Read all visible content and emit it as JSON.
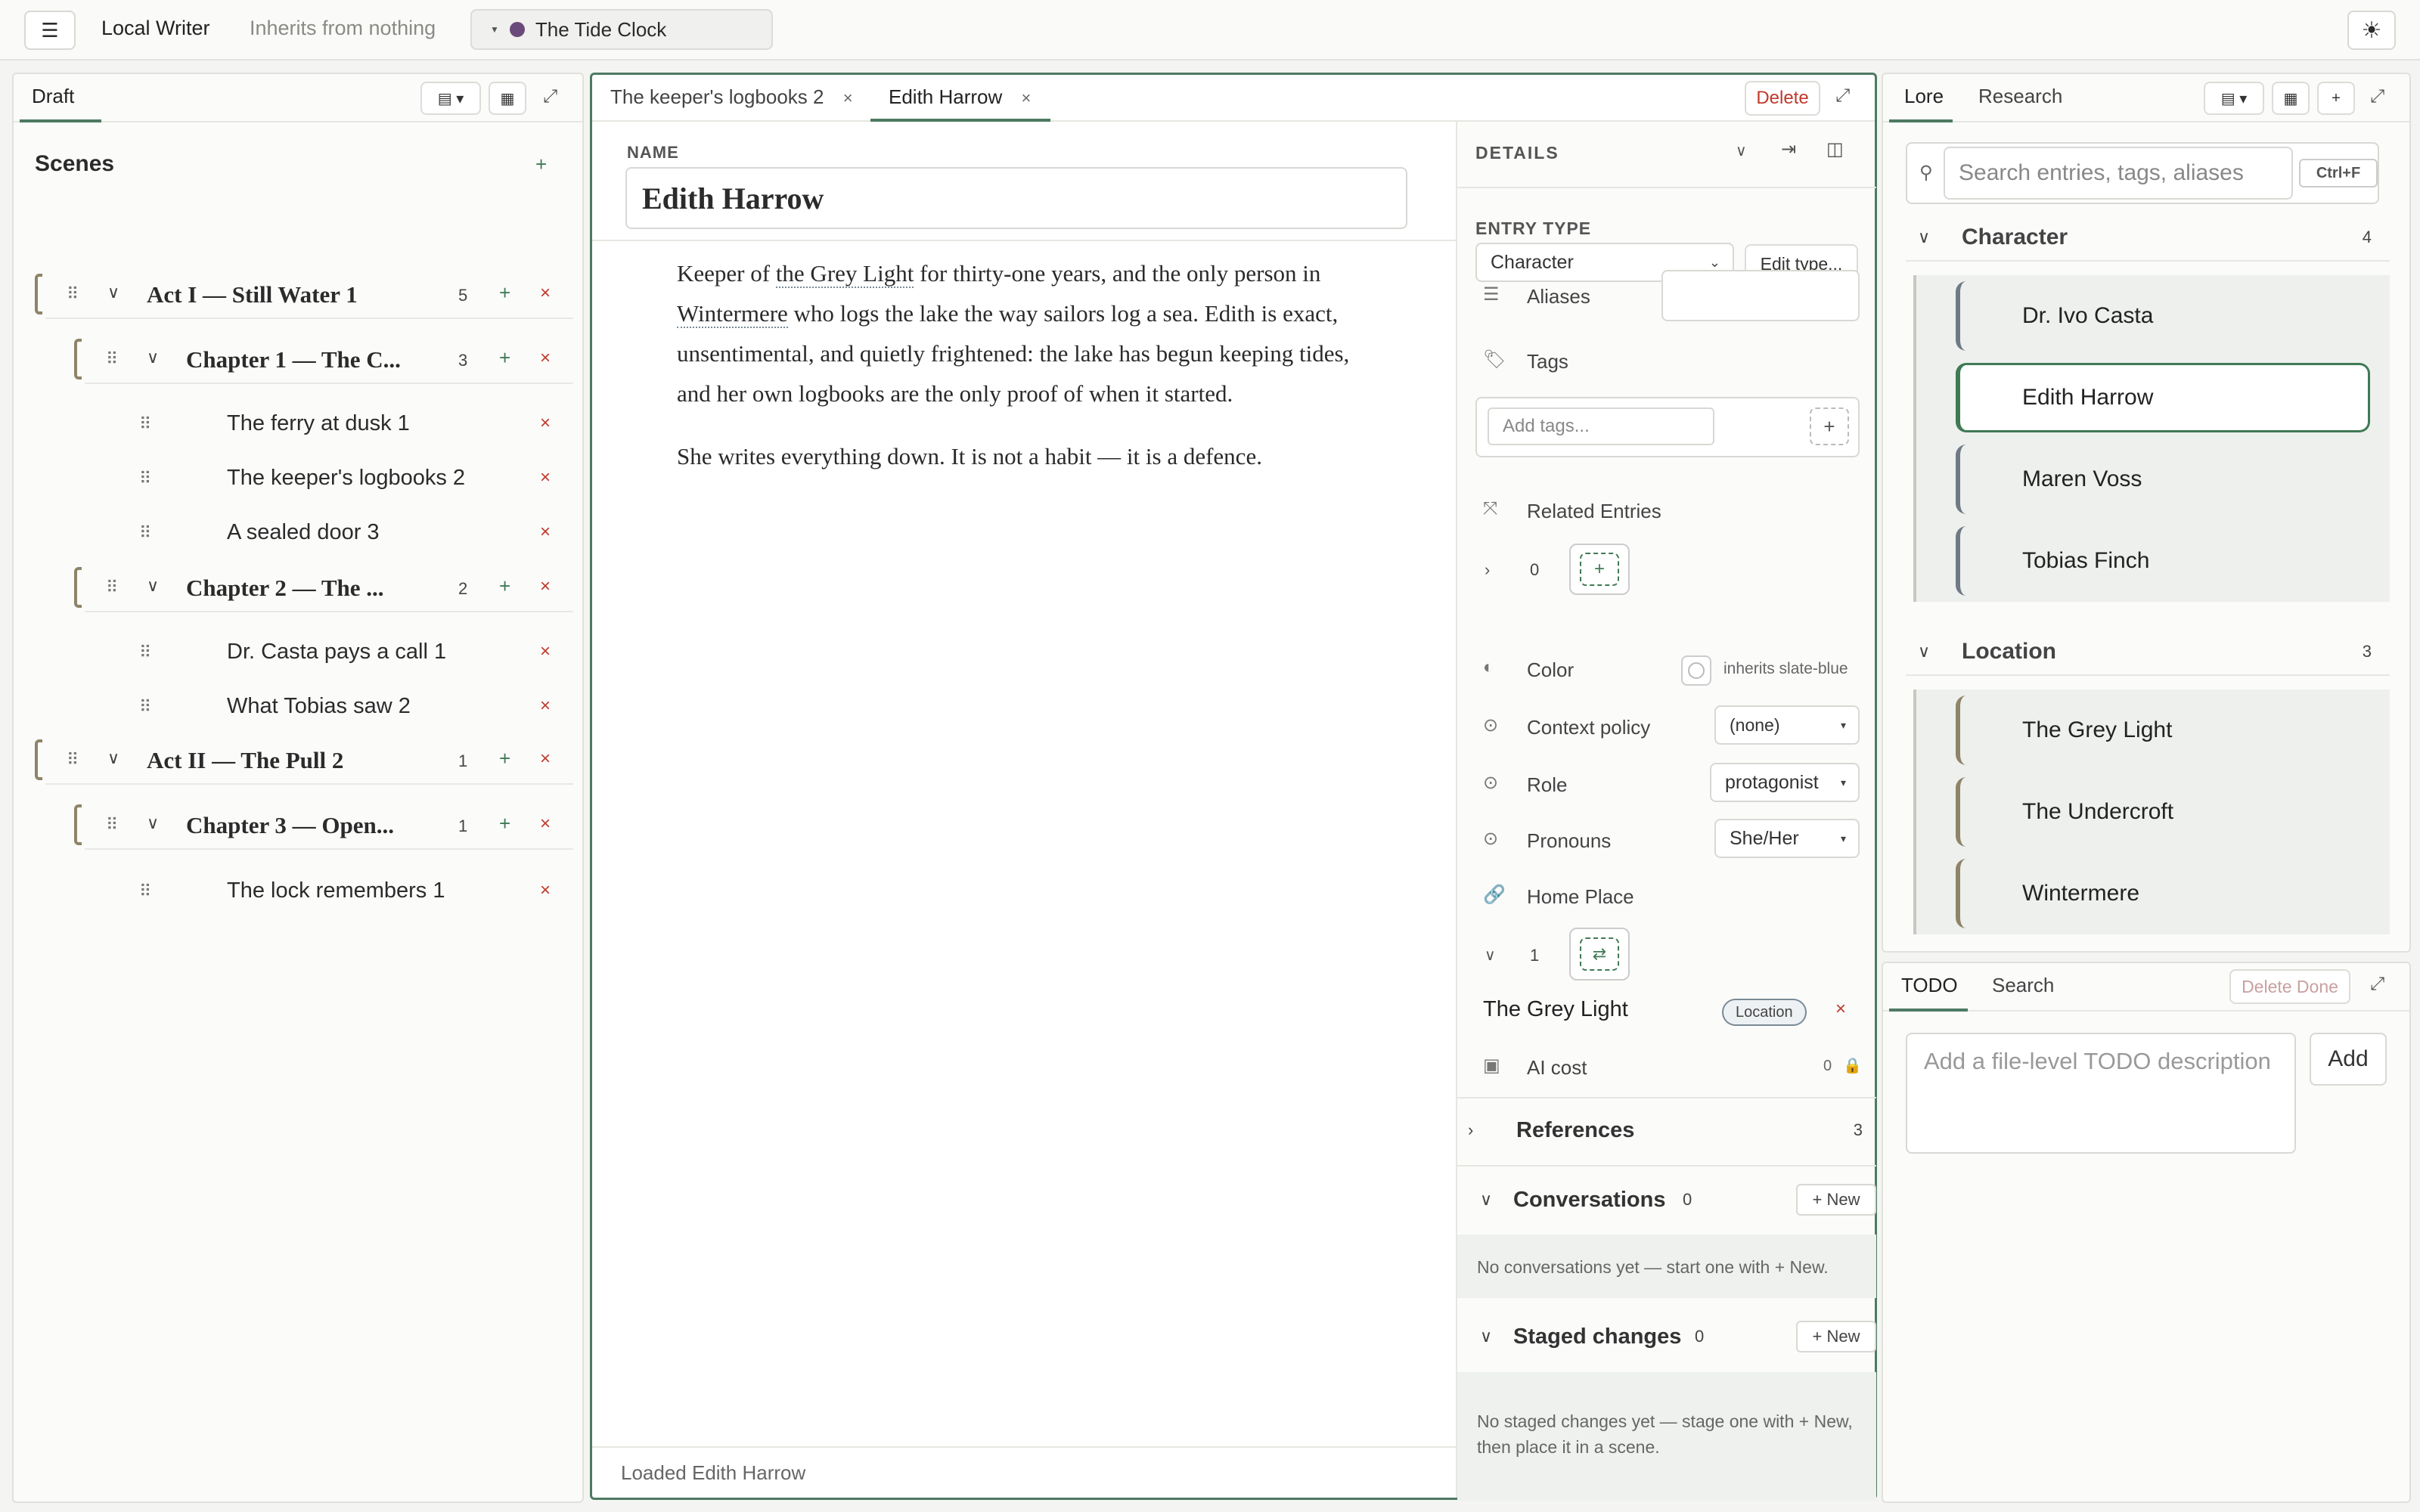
{
  "topbar": {
    "menu_icon": "hamburger-icon",
    "app_title": "Local Writer",
    "inherits": "Inherits from nothing",
    "project": "The Tide Clock",
    "project_color": "#6a4a7a",
    "theme_icon": "sun-icon"
  },
  "left": {
    "tab": "Draft",
    "scenes_title": "Scenes",
    "tree": [
      {
        "level": "act",
        "label": "Act I — Still Water 1",
        "count": "5"
      },
      {
        "level": "chapter",
        "label": "Chapter 1 — The C...",
        "count": "3"
      },
      {
        "level": "scene",
        "label": "The ferry at dusk 1"
      },
      {
        "level": "scene",
        "label": "The keeper's logbooks 2"
      },
      {
        "level": "scene",
        "label": "A sealed door 3"
      },
      {
        "level": "chapter",
        "label": "Chapter 2 — The ...",
        "count": "2"
      },
      {
        "level": "scene",
        "label": "Dr. Casta pays a call 1"
      },
      {
        "level": "scene",
        "label": "What Tobias saw 2"
      },
      {
        "level": "act",
        "label": "Act II — The Pull 2",
        "count": "1"
      },
      {
        "level": "chapter",
        "label": "Chapter 3 — Open...",
        "count": "1"
      },
      {
        "level": "scene",
        "label": "The lock remembers 1"
      }
    ]
  },
  "center": {
    "tabs": [
      "The keeper's logbooks 2",
      "Edith Harrow"
    ],
    "delete_label": "Delete",
    "name_label": "NAME",
    "name_value": "Edith Harrow",
    "body": {
      "p1_a": "Keeper of ",
      "p1_link1": "the Grey Light",
      "p1_b": " for thirty-one years, and the only person in ",
      "p1_link2": "Wintermere",
      "p1_c": " who logs the lake the way sailors log a sea. Edith is exact, unsentimental, and quietly frightened: the lake has begun keeping tides, and her own logbooks are the only proof of when it started.",
      "p2": "She writes everything down. It is not a habit — it is a defence."
    },
    "status": "Loaded Edith Harrow"
  },
  "details": {
    "title": "DETAILS",
    "entry_type_label": "ENTRY TYPE",
    "entry_type_value": "Character",
    "edit_type_label": "Edit type...",
    "aliases_label": "Aliases",
    "tags_label": "Tags",
    "tags_placeholder": "Add tags...",
    "related_label": "Related Entries",
    "related_count": "0",
    "color_label": "Color",
    "color_value": "inherits slate-blue",
    "context_label": "Context policy",
    "context_value": "(none)",
    "role_label": "Role",
    "role_value": "protagonist",
    "pronouns_label": "Pronouns",
    "pronouns_value": "She/Her",
    "home_label": "Home Place",
    "home_count": "1",
    "home_entry": "The Grey Light",
    "home_badge": "Location",
    "ai_cost_label": "AI cost",
    "ai_cost_value": "0",
    "references_label": "References",
    "references_count": "3",
    "conversations_label": "Conversations",
    "conversations_count": "0",
    "new_label": "+ New",
    "conversations_empty": "No conversations yet — start one with  + New.",
    "staged_label": "Staged changes",
    "staged_count": "0",
    "staged_empty": "No staged changes yet — stage one with  + New, then place it in a scene."
  },
  "lore": {
    "tabs": [
      "Lore",
      "Research"
    ],
    "search_placeholder": "Search entries, tags, aliases",
    "search_shortcut": "Ctrl+F",
    "groups": [
      {
        "name": "Character",
        "count": "4",
        "items": [
          "Dr. Ivo Casta",
          "Edith Harrow",
          "Maren Voss",
          "Tobias Finch"
        ]
      },
      {
        "name": "Location",
        "count": "3",
        "items": [
          "The Grey Light",
          "The Undercroft",
          "Wintermere"
        ]
      }
    ]
  },
  "todo": {
    "tabs": [
      "TODO",
      "Search"
    ],
    "delete_done": "Delete Done",
    "placeholder": "Add a file-level TODO description",
    "add_label": "Add"
  }
}
